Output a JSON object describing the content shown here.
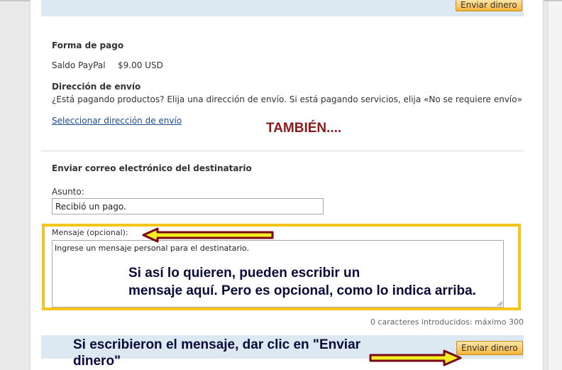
{
  "buttons": {
    "send_label": "Enviar dinero"
  },
  "payment": {
    "heading": "Forma de pago",
    "source": "Saldo PayPal",
    "amount": "$9.00 USD"
  },
  "shipping": {
    "heading": "Dirección de envío",
    "description": "¿Está pagando productos? Elija una dirección de envío. Si está pagando servicios, elija «No se requiere envío»",
    "select_link": "Seleccionar dirección de envío"
  },
  "email": {
    "heading": "Enviar correo electrónico del destinatario",
    "subject_label": "Asunto:",
    "subject_value": "Recibió un pago.",
    "message_label": "Mensaje (opcional):",
    "message_placeholder": "Ingrese un mensaje personal para el destinatario.",
    "char_counter": "0 caracteres introducidos: máximo 300"
  },
  "annotations": {
    "tambien": "TAMBIÉN....",
    "optional_line1": "Si así lo quieren, pueden escribir un",
    "optional_line2": "mensaje aquí.  Pero es opcional, como lo indica arriba.",
    "send_line1": "Si escribieron el mensaje, dar clic en \"Enviar",
    "send_line2": "dinero\""
  },
  "colors": {
    "highlight_border": "#f4c51c",
    "arrow_outline": "#7a0a14",
    "arrow_fill": "#f2ee22",
    "annotation_text": "#0b0b3b",
    "tambien_text": "#8b1a1a"
  }
}
